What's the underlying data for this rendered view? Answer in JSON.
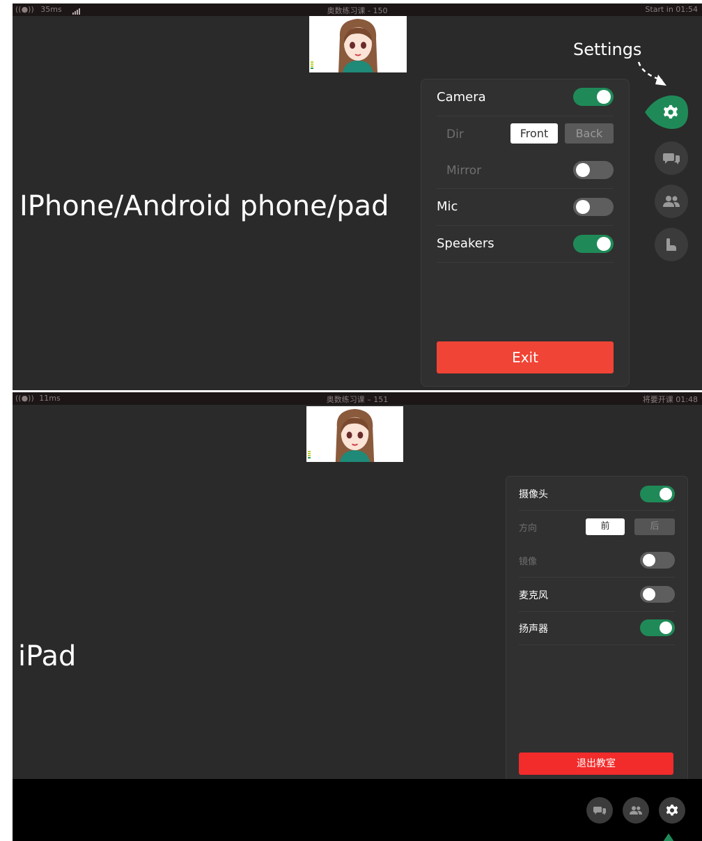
{
  "colors": {
    "accent_green": "#1f8a58",
    "exit_red": "#f04436",
    "toggle_off": "#5e5e5e",
    "background": "#2a2a2a"
  },
  "phone": {
    "label": "IPhone/Android phone/pad",
    "status": {
      "latency": "35ms",
      "title": "奥数练习课 - 150",
      "countdown": "Start in 01:54"
    },
    "annotation": "Settings",
    "settings": {
      "camera": {
        "label": "Camera",
        "on": true
      },
      "dir": {
        "label": "Dir",
        "front": "Front",
        "back": "Back",
        "selected": "Front"
      },
      "mirror": {
        "label": "Mirror",
        "on": false
      },
      "mic": {
        "label": "Mic",
        "on": false
      },
      "speakers": {
        "label": "Speakers",
        "on": true
      },
      "exit_label": "Exit"
    },
    "sidebar_icons": [
      "gear-icon",
      "chat-icon",
      "users-icon",
      "hand-raise-icon"
    ]
  },
  "ipad": {
    "label": "iPad",
    "status": {
      "latency": "11ms",
      "title": "奥数练习课 – 151",
      "countdown": "将要开课 01:48"
    },
    "settings": {
      "camera": {
        "label": "摄像头",
        "on": true
      },
      "dir": {
        "label": "方向",
        "front": "前",
        "back": "后",
        "selected": "前"
      },
      "mirror": {
        "label": "镜像",
        "on": false
      },
      "mic": {
        "label": "麦克风",
        "on": false
      },
      "speakers": {
        "label": "扬声器",
        "on": true
      },
      "exit_label": "退出教室"
    },
    "bottom_icons": [
      "chat-icon",
      "users-icon",
      "gear-icon"
    ]
  }
}
